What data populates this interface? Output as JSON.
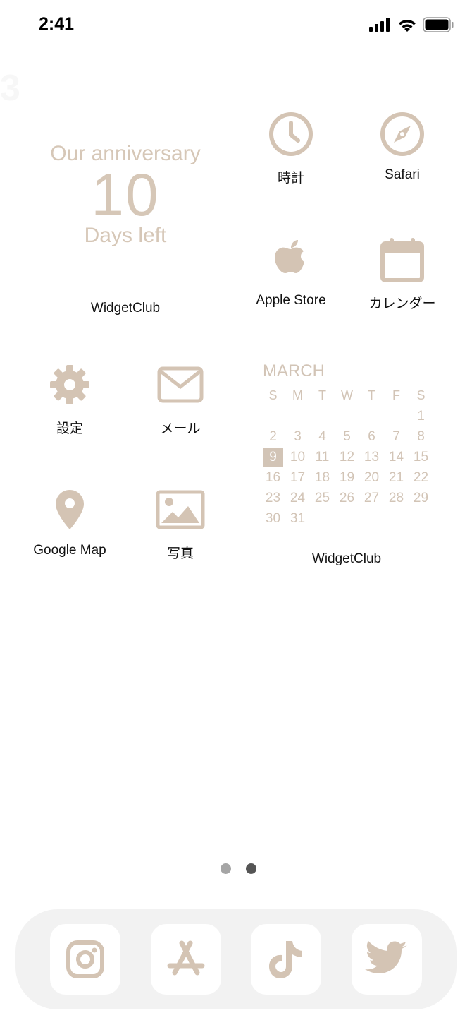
{
  "status_bar": {
    "time": "2:41",
    "icons": [
      "cellular-signal-icon",
      "wifi-icon",
      "battery-icon"
    ]
  },
  "ghost_text": "3",
  "accent_color": "#d4c4b4",
  "anniversary_widget": {
    "line1": "Our anniversary",
    "number": "10",
    "line2": "Days left",
    "label": "WidgetClub"
  },
  "apps": [
    {
      "label": "時計",
      "icon": "clock-icon"
    },
    {
      "label": "Safari",
      "icon": "compass-icon"
    },
    {
      "label": "Apple Store",
      "icon": "apple-icon"
    },
    {
      "label": "カレンダー",
      "icon": "calendar-icon"
    },
    {
      "label": "設定",
      "icon": "gear-icon"
    },
    {
      "label": "メール",
      "icon": "mail-icon"
    },
    {
      "label": "Google Map",
      "icon": "map-pin-icon"
    },
    {
      "label": "写真",
      "icon": "photo-icon"
    }
  ],
  "calendar_widget": {
    "month": "MARCH",
    "weekdays": [
      "S",
      "M",
      "T",
      "W",
      "T",
      "F",
      "S"
    ],
    "weeks": [
      [
        "",
        "",
        "",
        "",
        "",
        "",
        "1"
      ],
      [
        "2",
        "3",
        "4",
        "5",
        "6",
        "7",
        "8"
      ],
      [
        "9",
        "10",
        "11",
        "12",
        "13",
        "14",
        "15"
      ],
      [
        "16",
        "17",
        "18",
        "19",
        "20",
        "21",
        "22"
      ],
      [
        "23",
        "24",
        "25",
        "26",
        "27",
        "28",
        "29"
      ],
      [
        "30",
        "31",
        "",
        "",
        "",
        "",
        ""
      ]
    ],
    "today": "9",
    "label": "WidgetClub"
  },
  "page_indicator": {
    "pages": 2,
    "current": 2
  },
  "dock": [
    {
      "icon": "instagram-icon"
    },
    {
      "icon": "app-store-icon"
    },
    {
      "icon": "tiktok-icon"
    },
    {
      "icon": "twitter-icon"
    }
  ]
}
